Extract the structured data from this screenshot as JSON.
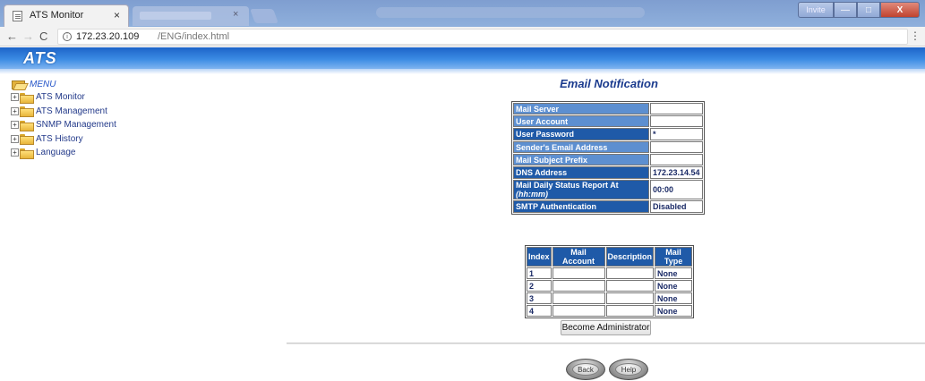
{
  "browser": {
    "active_tab_title": "ATS Monitor",
    "tab_close_glyph": "×",
    "inactive_tab_close_glyph": "×",
    "window_controls": {
      "invite": "Invite",
      "minimize": "—",
      "maximize": "□",
      "close": "X"
    },
    "nav": {
      "back": "←",
      "forward": "→",
      "reload": "C"
    },
    "url_host": "172.23.20.109",
    "url_path": "/ENG/index.html",
    "info_glyph": "i",
    "menu_glyph": "⋮"
  },
  "banner": {
    "logo": "ATS"
  },
  "menu": {
    "title": "MENU",
    "items": [
      {
        "label": "ATS Monitor"
      },
      {
        "label": "ATS Management"
      },
      {
        "label": "SNMP Management"
      },
      {
        "label": "ATS History"
      },
      {
        "label": "Language"
      }
    ],
    "expand_glyph": "+"
  },
  "page": {
    "title": "Email Notification",
    "settings": [
      {
        "label": "Mail Server",
        "value": ""
      },
      {
        "label": "User Account",
        "value": ""
      },
      {
        "label": "User Password",
        "value": "*"
      },
      {
        "label": "Sender's Email Address",
        "value": ""
      },
      {
        "label": "Mail Subject Prefix",
        "value": ""
      },
      {
        "label": "DNS Address",
        "value": "172.23.14.54"
      },
      {
        "label": "Mail Daily Status Report At ",
        "label_em": "(hh:mm)",
        "value": "00:00"
      },
      {
        "label": "SMTP Authentication",
        "value": "Disabled"
      }
    ],
    "accounts_table": {
      "headers": [
        "Index",
        "Mail Account",
        "Description",
        "Mail Type"
      ],
      "rows": [
        [
          "1",
          "",
          "",
          "None"
        ],
        [
          "2",
          "",
          "",
          "None"
        ],
        [
          "3",
          "",
          "",
          "None"
        ],
        [
          "4",
          "",
          "",
          "None"
        ]
      ]
    },
    "become_admin_label": "Become Administrator",
    "back_label": "Back",
    "help_label": "Help"
  },
  "colors": {
    "header_blue": "#1f5aa8",
    "light_header_blue": "#5d8fd0",
    "title_blue": "#1b3b8e",
    "banner_blue": "#2c78d8"
  }
}
